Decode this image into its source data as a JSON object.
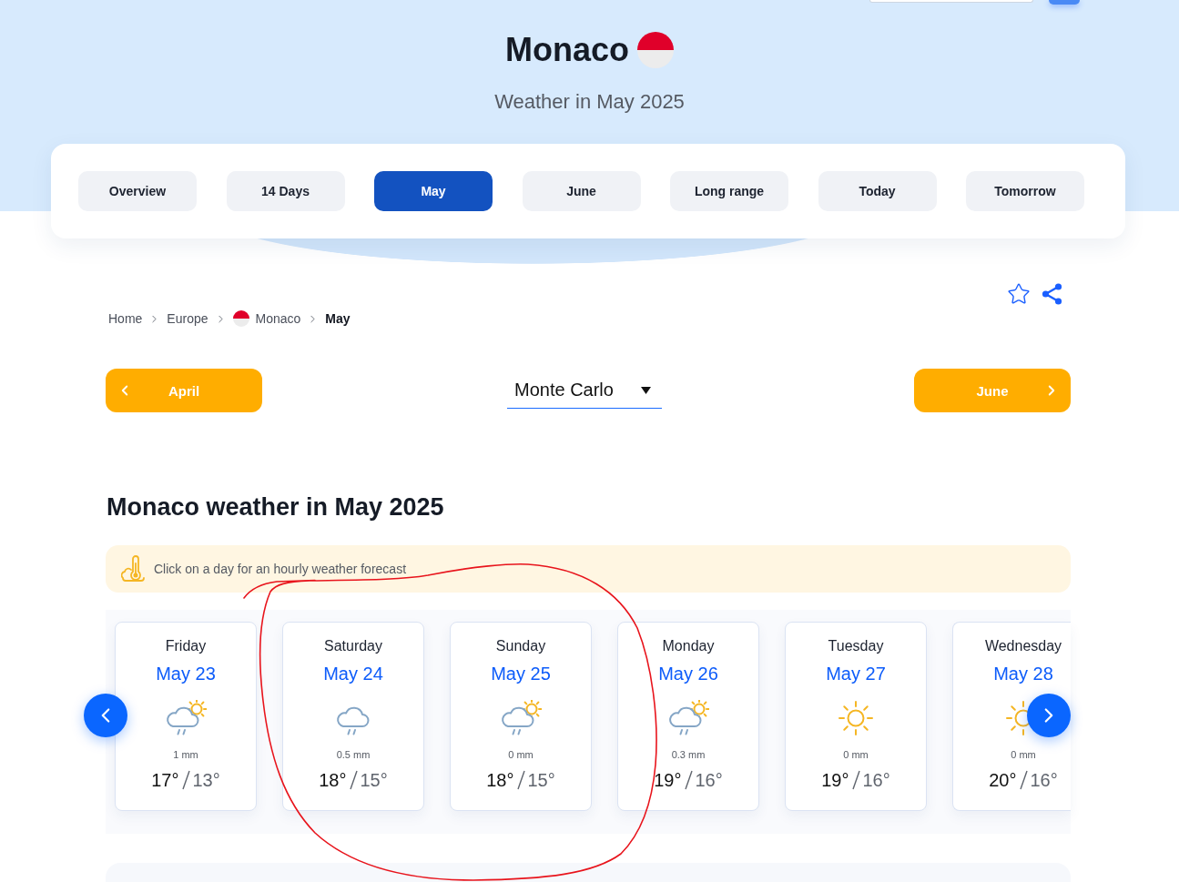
{
  "header": {
    "title": "Monaco",
    "subtitle": "Weather in May 2025"
  },
  "tabs": [
    {
      "label": "Overview",
      "selected": false
    },
    {
      "label": "14 Days",
      "selected": false
    },
    {
      "label": "May",
      "selected": true
    },
    {
      "label": "June",
      "selected": false
    },
    {
      "label": "Long range",
      "selected": false
    },
    {
      "label": "Today",
      "selected": false
    },
    {
      "label": "Tomorrow",
      "selected": false
    }
  ],
  "breadcrumb": [
    {
      "label": "Home",
      "kind": "plain",
      "current": false
    },
    {
      "label": "Europe",
      "kind": "plain",
      "current": false
    },
    {
      "label": "Monaco",
      "kind": "flag",
      "current": false
    },
    {
      "label": "May",
      "kind": "plain",
      "current": true
    }
  ],
  "month_nav": {
    "previous": {
      "label": "April"
    },
    "location": {
      "value": "Monte Carlo"
    },
    "next": {
      "label": "June"
    }
  },
  "section": {
    "heading": "Monaco weather in May 2025",
    "notice": "Click on a day for an hourly weather forecast"
  },
  "days": [
    {
      "day": "Friday",
      "date": "May 23",
      "kind": "showers",
      "precipitation": "1 mm",
      "high": "17°",
      "low": "13°"
    },
    {
      "day": "Saturday",
      "date": "May 24",
      "kind": "rain",
      "precipitation": "0.5 mm",
      "high": "18°",
      "low": "15°"
    },
    {
      "day": "Sunday",
      "date": "May 25",
      "kind": "showers",
      "precipitation": "0 mm",
      "high": "18°",
      "low": "15°"
    },
    {
      "day": "Monday",
      "date": "May 26",
      "kind": "showers",
      "precipitation": "0.3 mm",
      "high": "19°",
      "low": "16°"
    },
    {
      "day": "Tuesday",
      "date": "May 27",
      "kind": "clear",
      "precipitation": "0 mm",
      "high": "19°",
      "low": "16°"
    },
    {
      "day": "Wednesday",
      "date": "May 28",
      "kind": "clear",
      "precipitation": "0 mm",
      "high": "20°",
      "low": "16°"
    }
  ]
}
